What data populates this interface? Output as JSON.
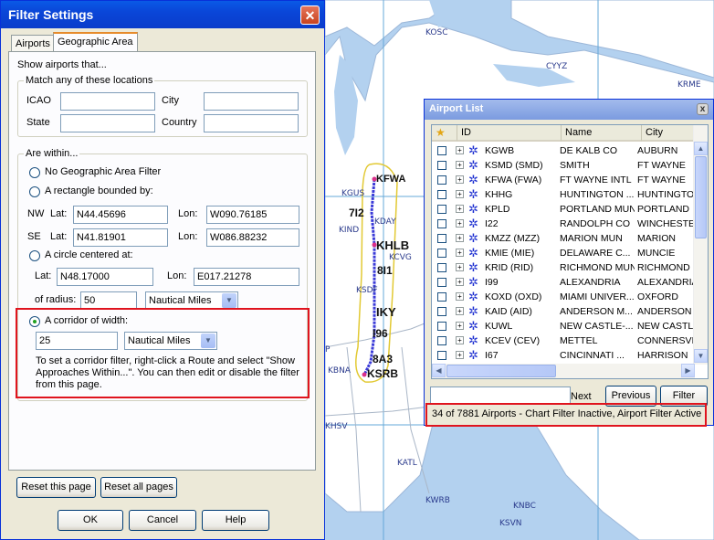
{
  "map": {
    "labels": [
      "KOSC",
      "CYYZ",
      "KRME",
      "KGUS",
      "KIND",
      "KCVG",
      "KSDF",
      "KBNA",
      "KHSV",
      "KATL",
      "KWRB",
      "KNBC",
      "KSVN",
      "KDAY",
      "KFWA",
      "KHLB",
      "KSRB",
      "P"
    ],
    "route_labels": [
      "KFWA",
      "7I2",
      "KHLB",
      "8I1",
      "IKY",
      "I96",
      "8A3",
      "KSRB"
    ]
  },
  "filter_dialog": {
    "title": "Filter Settings",
    "close": "✕",
    "tabs": [
      "Airports",
      "Geographic Area"
    ],
    "show_airports_label": "Show airports that...",
    "match_group": {
      "label": "Match any of these locations",
      "icao_label": "ICAO",
      "icao_value": "",
      "city_label": "City",
      "city_value": "",
      "state_label": "State",
      "state_value": "",
      "country_label": "Country",
      "country_value": ""
    },
    "within_group": {
      "label": "Are within...",
      "no_filter": "No Geographic Area Filter",
      "rectangle": "A rectangle bounded by:",
      "nw_label": "NW",
      "se_label": "SE",
      "lat_label": "Lat:",
      "lon_label": "Lon:",
      "nw_lat": "N44.45696",
      "nw_lon": "W090.76185",
      "se_lat": "N41.81901",
      "se_lon": "W086.88232",
      "circle": "A circle centered at:",
      "circle_lat": "N48.17000",
      "circle_lon": "E017.21278",
      "radius_label": "of radius:",
      "radius_value": "50",
      "radius_unit": "Nautical Miles",
      "corridor": "A corridor of width:",
      "corridor_value": "25",
      "corridor_unit": "Nautical Miles",
      "corridor_help": "To set a corridor filter, right-click a Route and select \"Show Approaches Within...\".  You can then edit or disable the filter from this page."
    },
    "reset_page": "Reset this page",
    "reset_all": "Reset all pages",
    "ok": "OK",
    "cancel": "Cancel",
    "help": "Help"
  },
  "airport_list": {
    "title": "Airport List",
    "close": "x",
    "columns": [
      "ID",
      "Name",
      "City"
    ],
    "rows": [
      {
        "id": "KGWB",
        "name": "DE KALB CO",
        "city": "AUBURN"
      },
      {
        "id": "KSMD (SMD)",
        "name": "SMITH",
        "city": "FT WAYNE"
      },
      {
        "id": "KFWA (FWA)",
        "name": "FT WAYNE INTL",
        "city": "FT WAYNE"
      },
      {
        "id": "KHHG",
        "name": "HUNTINGTON ...",
        "city": "HUNTINGTO"
      },
      {
        "id": "KPLD",
        "name": "PORTLAND MUN",
        "city": "PORTLAND"
      },
      {
        "id": "I22",
        "name": "RANDOLPH CO",
        "city": "WINCHESTE"
      },
      {
        "id": "KMZZ (MZZ)",
        "name": "MARION MUN",
        "city": "MARION"
      },
      {
        "id": "KMIE (MIE)",
        "name": "DELAWARE C...",
        "city": "MUNCIE"
      },
      {
        "id": "KRID (RID)",
        "name": "RICHMOND MUN",
        "city": "RICHMOND"
      },
      {
        "id": "I99",
        "name": "ALEXANDRIA",
        "city": "ALEXANDRIA"
      },
      {
        "id": "KOXD (OXD)",
        "name": "MIAMI UNIVER...",
        "city": "OXFORD"
      },
      {
        "id": "KAID (AID)",
        "name": "ANDERSON M...",
        "city": "ANDERSON"
      },
      {
        "id": "KUWL",
        "name": "NEW CASTLE-...",
        "city": "NEW CASTLE"
      },
      {
        "id": "KCEV (CEV)",
        "name": "METTEL",
        "city": "CONNERSVIL"
      },
      {
        "id": "I67",
        "name": "CINCINNATI ...",
        "city": "HARRISON"
      }
    ],
    "search_value": "",
    "next": "Next",
    "previous": "Previous",
    "filter": "Filter",
    "status": "34 of 7881 Airports - Chart Filter Inactive, Airport Filter Active"
  }
}
